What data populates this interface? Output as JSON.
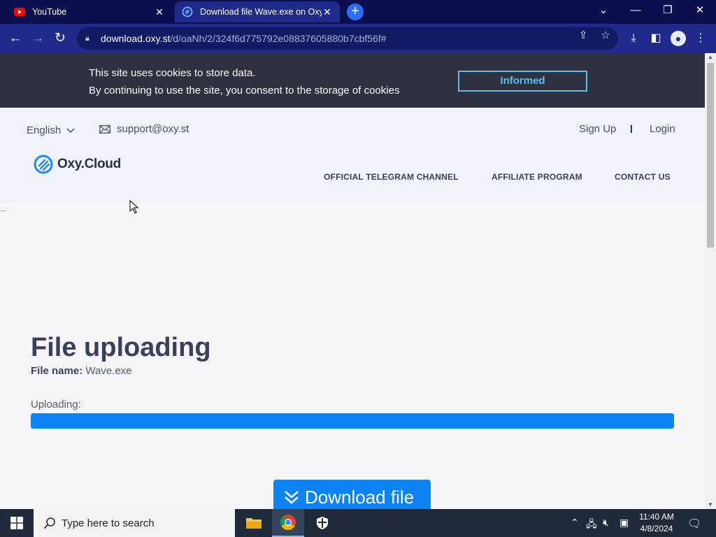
{
  "browser": {
    "tabs": [
      {
        "title": "YouTube",
        "active": false,
        "icon": "youtube-icon"
      },
      {
        "title": "Download file Wave.exe on Oxy.C",
        "active": true,
        "icon": "oxy-cloud-icon"
      }
    ],
    "url_host": "download.oxy.st",
    "url_path": "/d/oaNh/2/324f6d775792e08837605880b7cbf56f#"
  },
  "cookie_banner": {
    "line1": "This site uses cookies to store data.",
    "line2": "By continuing to use the site, you consent to the storage of cookies",
    "button": "Informed"
  },
  "header": {
    "language": "English",
    "email": "support@oxy.st",
    "sign_up": "Sign Up",
    "login": "Login",
    "logo_text": "Oxy.Cloud",
    "menu": [
      "OFFICIAL TELEGRAM CHANNEL",
      "AFFILIATE PROGRAM",
      "CONTACT US"
    ]
  },
  "main": {
    "heading": "File uploading",
    "file_name_label": "File name:",
    "file_name": "Wave.exe",
    "uploading_label": "Uploading:",
    "progress_fraction": 1.0,
    "download_button": "Download file"
  },
  "taskbar": {
    "search_placeholder": "Type here to search",
    "time": "11:40 AM",
    "date": "4/8/2024"
  },
  "colors": {
    "accent": "#0d84f5",
    "cookie_button": "#5cc0ec",
    "tab_strip": "#0b0f4d",
    "toolbar": "#1f2a8a"
  }
}
